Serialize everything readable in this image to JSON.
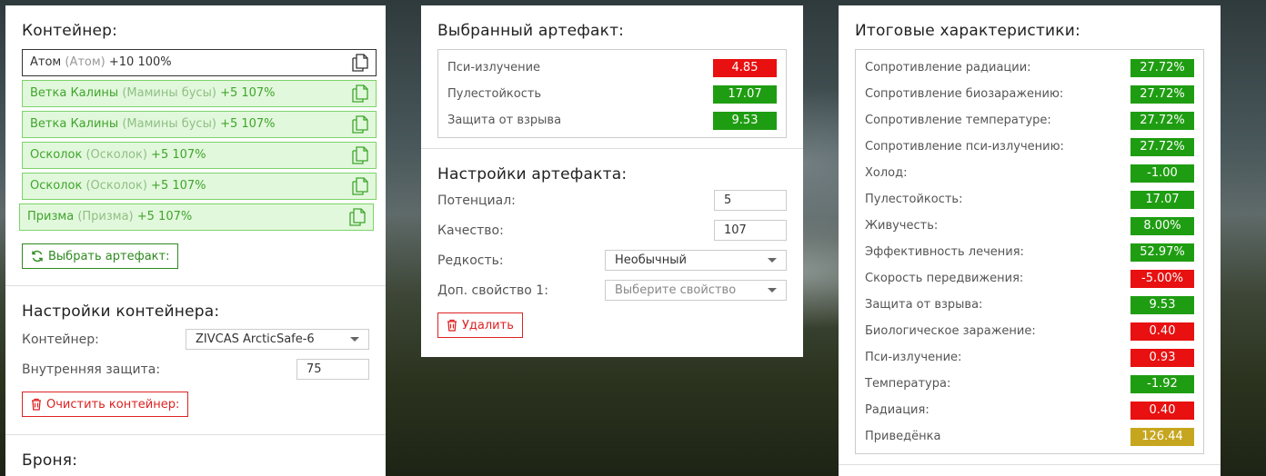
{
  "container_panel": {
    "title": "Контейнер:",
    "items": [
      {
        "name": "Атом",
        "alt": "(Атом)",
        "bonus": "+10 100%",
        "style": "plain"
      },
      {
        "name": "Ветка Калины",
        "alt": "(Мамины бусы)",
        "bonus": "+5 107%",
        "style": "green"
      },
      {
        "name": "Ветка Калины",
        "alt": "(Мамины бусы)",
        "bonus": "+5 107%",
        "style": "green"
      },
      {
        "name": "Осколок",
        "alt": "(Осколок)",
        "bonus": "+5 107%",
        "style": "green"
      },
      {
        "name": "Осколок",
        "alt": "(Осколок)",
        "bonus": "+5 107%",
        "style": "green"
      },
      {
        "name": "Призма",
        "alt": "(Призма)",
        "bonus": "+5 107%",
        "style": "green"
      }
    ],
    "select_button_label": "Выбрать артефакт:"
  },
  "container_settings": {
    "title": "Настройки контейнера:",
    "container_label": "Контейнер:",
    "container_value": "ZIVCAS ArcticSafe-6",
    "inner_protection_label": "Внутренняя защита:",
    "inner_protection_value": "75",
    "clear_button_label": "Очистить контейнер:"
  },
  "armor_section": {
    "title": "Броня:"
  },
  "selected_artifact": {
    "title": "Выбранный артефакт:",
    "stats": [
      {
        "label": "Пси-излучение",
        "value": "4.85",
        "color": "red"
      },
      {
        "label": "Пулестойкость",
        "value": "17.07",
        "color": "green"
      },
      {
        "label": "Защита от взрыва",
        "value": "9.53",
        "color": "green"
      }
    ]
  },
  "artifact_settings": {
    "title": "Настройки артефакта:",
    "potential_label": "Потенциал:",
    "potential_value": "5",
    "quality_label": "Качество:",
    "quality_value": "107",
    "rarity_label": "Редкость:",
    "rarity_value": "Необычный",
    "extra_label": "Доп. свойство 1:",
    "extra_placeholder": "Выберите свойство",
    "delete_button_label": "Удалить"
  },
  "totals": {
    "title": "Итоговые характеристики:",
    "stats": [
      {
        "label": "Сопротивление радиации:",
        "value": "27.72%",
        "color": "green"
      },
      {
        "label": "Сопротивление биозаражению:",
        "value": "27.72%",
        "color": "green"
      },
      {
        "label": "Сопротивление температуре:",
        "value": "27.72%",
        "color": "green"
      },
      {
        "label": "Сопротивление пси-излучению:",
        "value": "27.72%",
        "color": "green"
      },
      {
        "label": "Холод:",
        "value": "-1.00",
        "color": "green"
      },
      {
        "label": "Пулестойкость:",
        "value": "17.07",
        "color": "green"
      },
      {
        "label": "Живучесть:",
        "value": "8.00%",
        "color": "green"
      },
      {
        "label": "Эффективность лечения:",
        "value": "52.97%",
        "color": "green"
      },
      {
        "label": "Скорость передвижения:",
        "value": "-5.00%",
        "color": "red"
      },
      {
        "label": "Защита от взрыва:",
        "value": "9.53",
        "color": "green"
      },
      {
        "label": "Биологическое заражение:",
        "value": "0.40",
        "color": "red"
      },
      {
        "label": "Пси-излучение:",
        "value": "0.93",
        "color": "red"
      },
      {
        "label": "Температура:",
        "value": "-1.92",
        "color": "green"
      },
      {
        "label": "Радиация:",
        "value": "0.40",
        "color": "red"
      },
      {
        "label": "Приведёнка",
        "value": "126.44",
        "color": "gold"
      }
    ]
  },
  "colors": {
    "green": "#1f9d12",
    "red": "#e81010",
    "gold": "#c6a61f",
    "item_green_bg": "#e2f8dc",
    "item_green_text": "#3fa52c"
  }
}
